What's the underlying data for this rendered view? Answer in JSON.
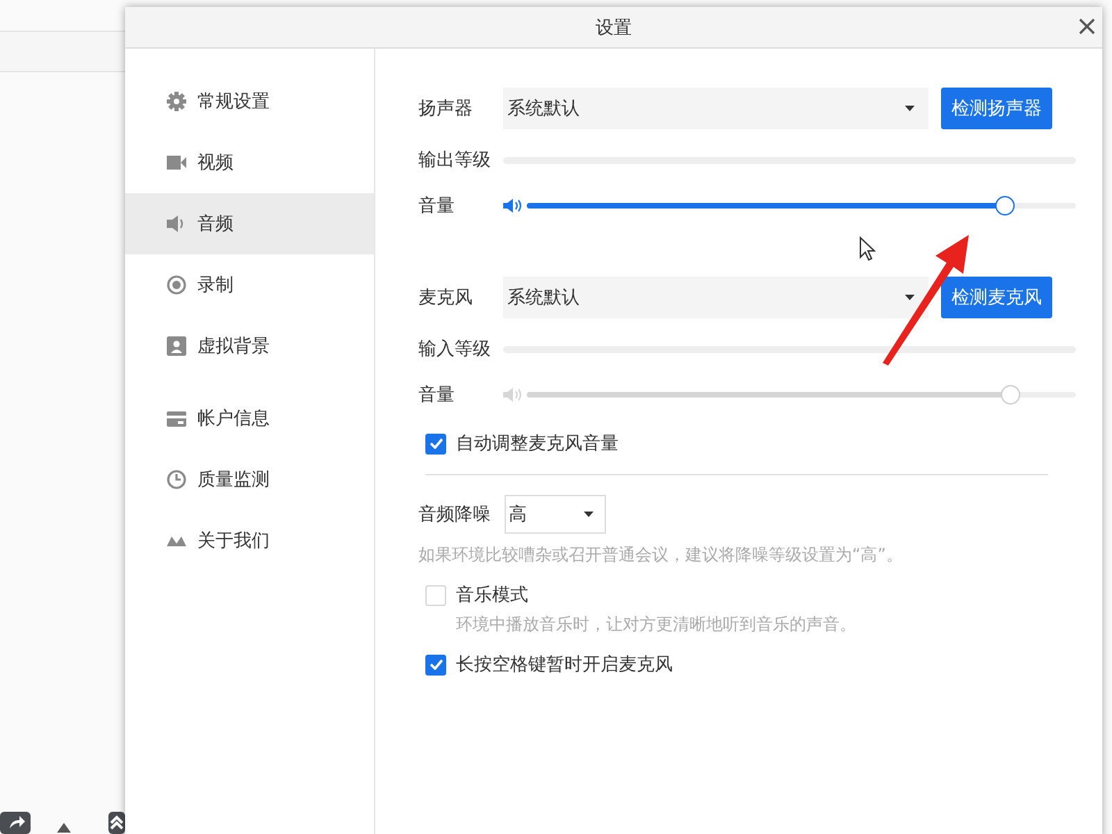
{
  "dialog": {
    "title": "设置"
  },
  "sidebar": {
    "items": [
      {
        "label": "常规设置",
        "selected": false
      },
      {
        "label": "视频",
        "selected": false
      },
      {
        "label": "音频",
        "selected": true
      },
      {
        "label": "录制",
        "selected": false
      },
      {
        "label": "虚拟背景",
        "selected": false
      },
      {
        "label": "帐户信息",
        "selected": false
      },
      {
        "label": "质量监测",
        "selected": false
      },
      {
        "label": "关于我们",
        "selected": false
      }
    ]
  },
  "devices": [
    {
      "label": "扬声器",
      "device": "系统默认",
      "button": "检测扬声器",
      "level_label": "输出等级",
      "volume_label": "音量",
      "volume": {
        "level": 0.87,
        "disabled": false
      }
    },
    {
      "label": "麦克风",
      "device": "系统默认",
      "button": "检测麦克风",
      "level_label": "输入等级",
      "volume_label": "音量",
      "volume": {
        "level": 0.88,
        "disabled": true
      }
    }
  ],
  "auto_adjust": {
    "label": "自动调整麦克风音量",
    "checked": true
  },
  "noise": {
    "label": "音频降噪",
    "value": "高",
    "hint": "如果环境比较嘈杂或召开普通会议，建议将降噪等级设置为“高”。"
  },
  "options": [
    {
      "label": "音乐模式",
      "checked": false,
      "description": "环境中播放音乐时，让对方更清晰地听到音乐的声音。"
    },
    {
      "label": "长按空格键暂时开启麦克风",
      "checked": true
    }
  ]
}
